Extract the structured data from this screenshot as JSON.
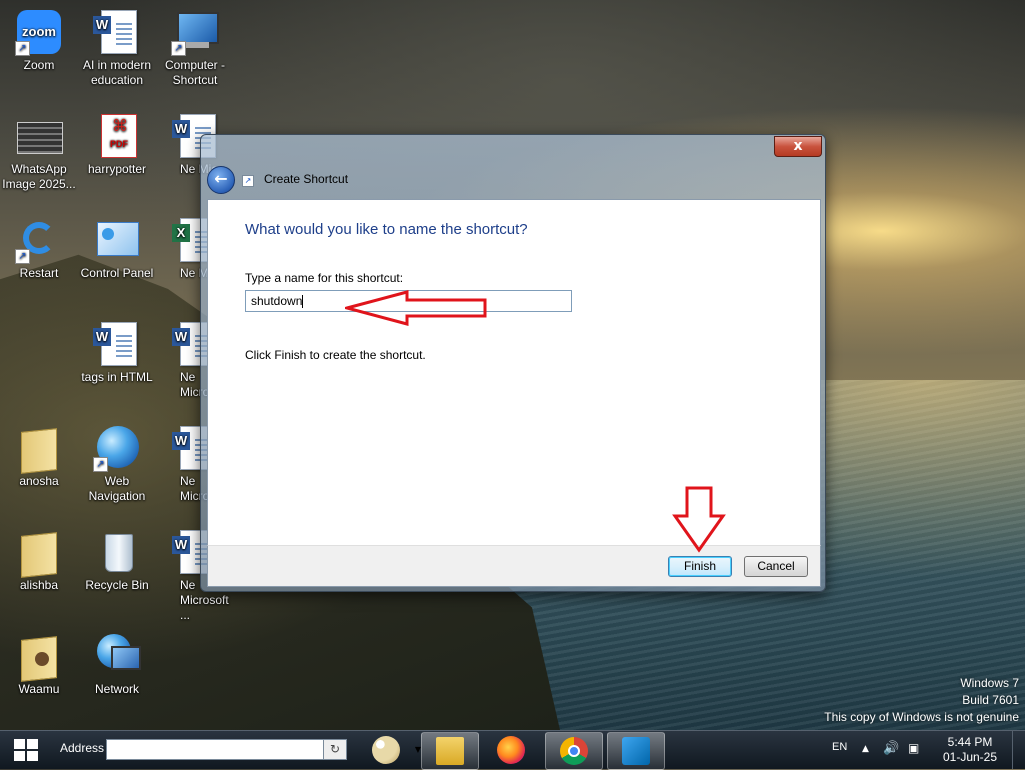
{
  "desktop": {
    "icons": [
      {
        "label": "Zoom"
      },
      {
        "label": "AI in modern education"
      },
      {
        "label": "Computer - Shortcut"
      },
      {
        "label": "WhatsApp Image 2025..."
      },
      {
        "label": "harrypotter"
      },
      {
        "label": "Ne Micro"
      },
      {
        "label": "Restart"
      },
      {
        "label": "Control Panel"
      },
      {
        "label": "Ne Micro"
      },
      {
        "label": "tags in HTML"
      },
      {
        "label": "Ne Micros"
      },
      {
        "label": "anosha"
      },
      {
        "label": "Web Navigation"
      },
      {
        "label": "Ne Micros"
      },
      {
        "label": "alishba"
      },
      {
        "label": "Recycle Bin"
      },
      {
        "label": "Ne Microsoft ..."
      },
      {
        "label": "Waamu"
      },
      {
        "label": "Network"
      }
    ],
    "icon_texts": {
      "zoom_logo": "zoom",
      "pdf_badge": "PDF",
      "word_badge": "W",
      "excel_badge": "X"
    },
    "watermark": {
      "line1": "Windows 7",
      "line2": "Build 7601",
      "line3": "This copy of Windows is not genuine"
    }
  },
  "dialog": {
    "title": "Create Shortcut",
    "close_glyph": "x",
    "heading": "What would you like to name the shortcut?",
    "field_label": "Type a name for this shortcut:",
    "name_value": "shutdown",
    "hint": "Click Finish to create the shortcut.",
    "buttons": {
      "finish": "Finish",
      "cancel": "Cancel"
    }
  },
  "annotations": {
    "arrow_color": "#e0141b"
  },
  "taskbar": {
    "address_label": "Address",
    "address_value": "",
    "apps": [
      "paint-icon",
      "file-explorer-icon",
      "firefox-icon",
      "chrome-icon",
      "vscode-icon"
    ],
    "tray": {
      "language": "EN",
      "time": "5:44 PM",
      "date": "01-Jun-25"
    }
  }
}
